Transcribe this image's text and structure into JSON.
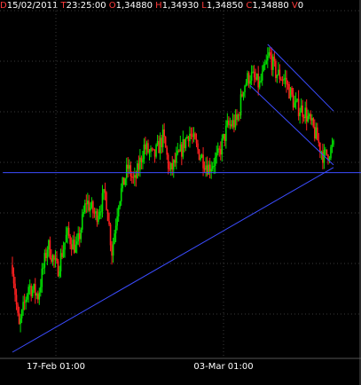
{
  "header": {
    "date_label": "D",
    "date_value": "15/02/2011",
    "time_label": "T",
    "time_value": "23:25:00",
    "open_label": "O",
    "open_value": "1,34880",
    "high_label": "H",
    "high_value": "1,34930",
    "low_label": "L",
    "low_value": "1,34850",
    "close_label": "C",
    "close_value": "1,34880",
    "volume_label": "V",
    "volume_value": "0"
  },
  "colors": {
    "background": "#000000",
    "grid": "#3a3a3a",
    "bull_candle": "#00e000",
    "bear_candle": "#ff2020",
    "trendline": "#3b4cff",
    "label_text": "#ffffff",
    "header_label": "#ff3b3b"
  },
  "chart_data": {
    "type": "candlestick",
    "title": "",
    "xlabel": "",
    "ylabel": "",
    "x_tick_labels": [
      "17-Feb 01:00",
      "03-Mar 01:00"
    ],
    "grid": true,
    "legend": "none",
    "price_path": [
      {
        "t": 0.0,
        "p": 0.3
      },
      {
        "t": 0.02,
        "p": 0.05
      },
      {
        "t": 0.05,
        "p": 0.22
      },
      {
        "t": 0.08,
        "p": 0.18
      },
      {
        "t": 0.11,
        "p": 0.38
      },
      {
        "t": 0.14,
        "p": 0.28
      },
      {
        "t": 0.17,
        "p": 0.42
      },
      {
        "t": 0.2,
        "p": 0.36
      },
      {
        "t": 0.23,
        "p": 0.55
      },
      {
        "t": 0.26,
        "p": 0.49
      },
      {
        "t": 0.29,
        "p": 0.58
      },
      {
        "t": 0.31,
        "p": 0.35
      },
      {
        "t": 0.33,
        "p": 0.55
      },
      {
        "t": 0.36,
        "p": 0.68
      },
      {
        "t": 0.38,
        "p": 0.62
      },
      {
        "t": 0.41,
        "p": 0.76
      },
      {
        "t": 0.44,
        "p": 0.72
      },
      {
        "t": 0.47,
        "p": 0.8
      },
      {
        "t": 0.49,
        "p": 0.66
      },
      {
        "t": 0.52,
        "p": 0.73
      },
      {
        "t": 0.55,
        "p": 0.82
      },
      {
        "t": 0.58,
        "p": 0.74
      },
      {
        "t": 0.61,
        "p": 0.68
      },
      {
        "t": 0.64,
        "p": 0.72
      },
      {
        "t": 0.67,
        "p": 0.84
      },
      {
        "t": 0.7,
        "p": 0.86
      },
      {
        "t": 0.72,
        "p": 1.0
      },
      {
        "t": 0.74,
        "p": 1.04
      },
      {
        "t": 0.77,
        "p": 1.0
      },
      {
        "t": 0.8,
        "p": 1.12
      },
      {
        "t": 0.82,
        "p": 1.05
      },
      {
        "t": 0.85,
        "p": 1.02
      },
      {
        "t": 0.88,
        "p": 0.92
      },
      {
        "t": 0.91,
        "p": 0.9
      },
      {
        "t": 0.94,
        "p": 0.82
      },
      {
        "t": 0.97,
        "p": 0.72
      },
      {
        "t": 1.0,
        "p": 0.76
      }
    ],
    "trend_lines": [
      {
        "name": "support-line",
        "from": {
          "t": 0.0,
          "p": -0.04
        },
        "to": {
          "t": 1.0,
          "p": 0.68
        }
      },
      {
        "name": "horizontal-line",
        "from": {
          "t": -0.03,
          "p": 0.66
        },
        "to": {
          "t": 1.1,
          "p": 0.66
        }
      },
      {
        "name": "channel-upper",
        "from": {
          "t": 0.795,
          "p": 1.16
        },
        "to": {
          "t": 1.0,
          "p": 0.9
        }
      },
      {
        "name": "channel-lower",
        "from": {
          "t": 0.74,
          "p": 1.0
        },
        "to": {
          "t": 1.0,
          "p": 0.69
        }
      }
    ]
  }
}
